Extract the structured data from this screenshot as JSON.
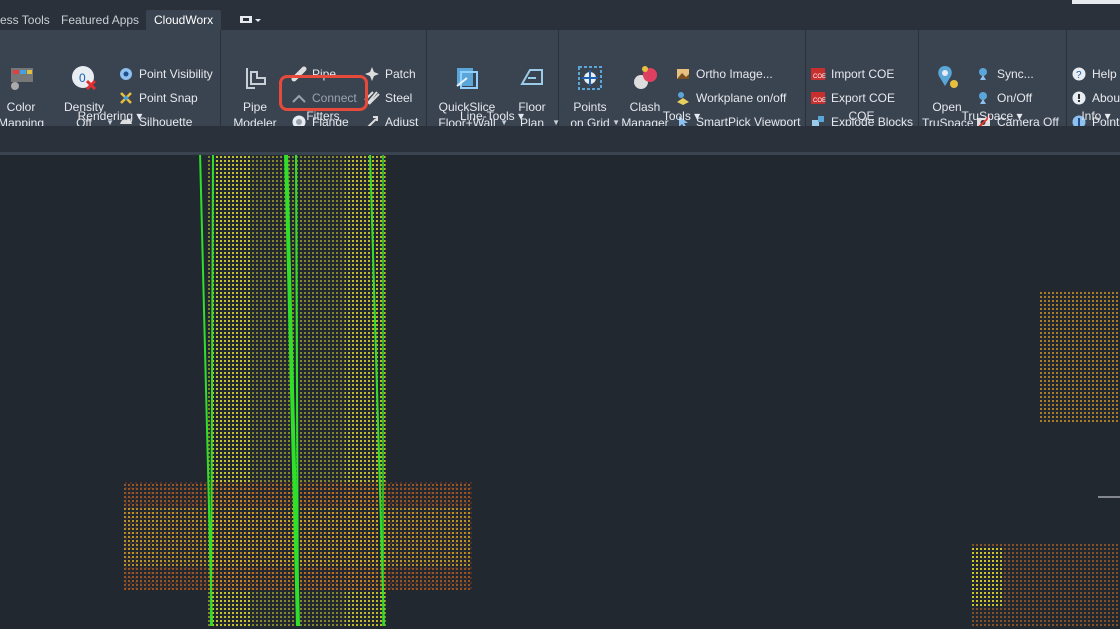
{
  "tabs": [
    {
      "label": "ess Tools",
      "active": false
    },
    {
      "label": "Featured Apps",
      "active": false
    },
    {
      "label": "CloudWorx",
      "active": true
    }
  ],
  "panels": {
    "rendering": {
      "title": "Rendering ▾",
      "color_mapping": "Color\nMapping",
      "density_off": "Density\nOff",
      "point_visibility": "Point Visibility",
      "point_snap": "Point Snap",
      "silhouette": "Silhouette"
    },
    "fitters": {
      "title": "Fitters",
      "pipe_modeler": "Pipe\nModeler",
      "pipe": "Pipe",
      "connect": "Connect",
      "flange": "Flange",
      "patch": "Patch",
      "steel": "Steel",
      "adjust": "Adjust"
    },
    "line_tools": {
      "title": "Line-Tools ▾",
      "quickslice": "QuickSlice\nFloor+Wall",
      "floor_plan": "Floor\nPlan"
    },
    "tools": {
      "title": "Tools ▾",
      "points_on_grid": "Points\non Grid",
      "clash_manager": "Clash\nManager",
      "ortho_image": "Ortho Image...",
      "workplane": "Workplane on/off",
      "smartpick": "SmartPick Viewport"
    },
    "coe": {
      "title": "COE",
      "import": "Import COE",
      "export": "Export COE",
      "explode": "Explode Blocks"
    },
    "truspace": {
      "title": "TruSpace ▾",
      "open": "Open\nTruSpace",
      "sync": "Sync...",
      "onoff": "On/Off",
      "camera": "Camera Off"
    },
    "info": {
      "title": "Info ▾",
      "help": "Help",
      "about": "About",
      "point": "Point"
    }
  },
  "colors": {
    "ribbon_bg": "#3a4350",
    "tab_bar_bg": "#2a313a",
    "viewport_bg": "#212830",
    "highlight": "#e64a3b",
    "pipe_line": "#2ee02a",
    "cloud_yellow": "#d6d12a",
    "cloud_orange": "#c86a1e"
  }
}
